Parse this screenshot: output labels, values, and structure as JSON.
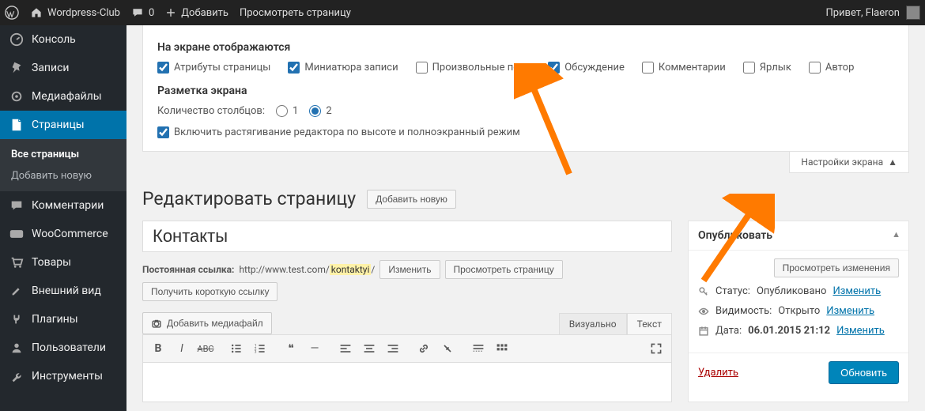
{
  "adminbar": {
    "site_name": "Wordpress-Club",
    "comments_count": "0",
    "add_new": "Добавить",
    "view_page": "Просмотреть страницу",
    "greeting": "Привет, Flaeron"
  },
  "sidemenu": {
    "items": [
      {
        "label": "Консоль"
      },
      {
        "label": "Записи"
      },
      {
        "label": "Медиафайлы"
      },
      {
        "label": "Страницы",
        "current": true
      },
      {
        "label": "Комментарии"
      },
      {
        "label": "WooCommerce"
      },
      {
        "label": "Товары"
      },
      {
        "label": "Внешний вид"
      },
      {
        "label": "Плагины"
      },
      {
        "label": "Пользователи"
      },
      {
        "label": "Инструменты"
      }
    ],
    "sub": {
      "all": "Все страницы",
      "add": "Добавить новую"
    }
  },
  "screen_options": {
    "heading_show": "На экране отображаются",
    "checks": [
      {
        "label": "Атрибуты страницы",
        "checked": true
      },
      {
        "label": "Миниатюра записи",
        "checked": true
      },
      {
        "label": "Произвольные поля",
        "checked": false
      },
      {
        "label": "Обсуждение",
        "checked": true
      },
      {
        "label": "Комментарии",
        "checked": false
      },
      {
        "label": "Ярлык",
        "checked": false
      },
      {
        "label": "Автор",
        "checked": false
      }
    ],
    "heading_layout": "Разметка экрана",
    "columns_label": "Количество столбцов:",
    "columns": {
      "one": "1",
      "two": "2",
      "selected": "2"
    },
    "stretch": {
      "label": "Включить растягивание редактора по высоте и полноэкранный режим",
      "checked": true
    },
    "toggle_tab": "Настройки экрана"
  },
  "page_edit": {
    "title": "Редактировать страницу",
    "add_new": "Добавить новую"
  },
  "post": {
    "title": "Контакты"
  },
  "permalink": {
    "label": "Постоянная ссылка:",
    "url_prefix": "http://www.test.com/",
    "slug": "kontaktyi",
    "edit": "Изменить",
    "view": "Просмотреть страницу",
    "shortlink": "Получить короткую ссылку"
  },
  "editor": {
    "add_media": "Добавить медиафайл",
    "tab_visual": "Визуально",
    "tab_text": "Текст"
  },
  "publish": {
    "heading": "Опубликовать",
    "preview_changes": "Просмотреть изменения",
    "status_label": "Статус:",
    "status_value": "Опубликовано",
    "status_edit": "Изменить",
    "visibility_label": "Видимость:",
    "visibility_value": "Открыто",
    "visibility_edit": "Изменить",
    "date_label": "Дата:",
    "date_value": "06.01.2015 21:12",
    "date_edit": "Изменить",
    "delete": "Удалить",
    "update": "Обновить"
  }
}
